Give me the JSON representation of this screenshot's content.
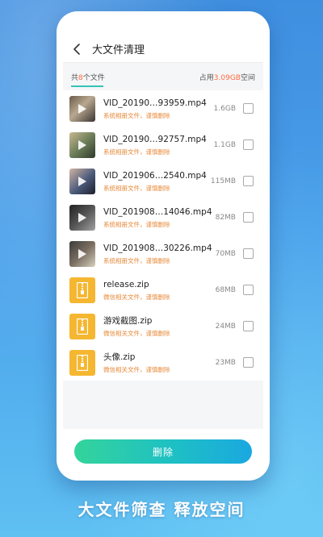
{
  "header": {
    "title": "大文件清理"
  },
  "summary": {
    "count_prefix": "共",
    "count_value": "8",
    "count_suffix": "个文件",
    "space_prefix": "占用",
    "space_value": "3.09GB",
    "space_suffix": "空间"
  },
  "files": [
    {
      "name": "VID_20190…93959.mp4",
      "note": "系统相册文件，谨慎删除",
      "size": "1.6GB",
      "type": "video"
    },
    {
      "name": "VID_20190…92757.mp4",
      "note": "系统相册文件，谨慎删除",
      "size": "1.1GB",
      "type": "video"
    },
    {
      "name": "VID_201906…2540.mp4",
      "note": "系统相册文件，谨慎删除",
      "size": "115MB",
      "type": "video"
    },
    {
      "name": "VID_201908…14046.mp4",
      "note": "系统相册文件，谨慎删除",
      "size": "82MB",
      "type": "video"
    },
    {
      "name": "VID_201908…30226.mp4",
      "note": "系统相册文件，谨慎删除",
      "size": "70MB",
      "type": "video"
    },
    {
      "name": "release.zip",
      "note": "微信相关文件，谨慎删除",
      "size": "68MB",
      "type": "zip"
    },
    {
      "name": "游戏截图.zip",
      "note": "微信相关文件，谨慎删除",
      "size": "24MB",
      "type": "zip"
    },
    {
      "name": "头像.zip",
      "note": "微信相关文件，谨慎删除",
      "size": "23MB",
      "type": "zip"
    }
  ],
  "actions": {
    "delete_label": "删除"
  },
  "tagline": "大文件筛查 释放空间",
  "colors": {
    "accent_orange": "#ff6a3d",
    "note_orange": "#e78a3a",
    "button_start": "#34d49b",
    "button_end": "#1aa8e0",
    "zip_yellow": "#f5b731"
  },
  "icons": {
    "back": "chevron-left-icon",
    "play": "play-icon",
    "zip": "zip-file-icon"
  }
}
